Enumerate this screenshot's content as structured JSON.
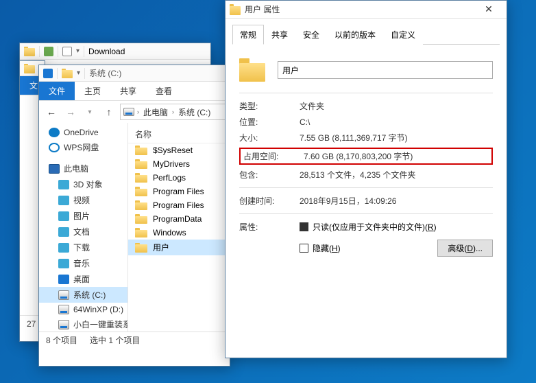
{
  "win_download": {
    "title": "Download"
  },
  "win_c": {
    "title": "系统 (C:)",
    "ribbon": {
      "file": "文件",
      "home": "主页",
      "share": "共享",
      "view": "查看"
    },
    "breadcrumb": {
      "pc": "此电脑",
      "c": "系统 (C:)"
    },
    "tree": {
      "onedrive": "OneDrive",
      "wps": "WPS网盘",
      "thispc": "此电脑",
      "threed": "3D 对象",
      "video": "视频",
      "pictures": "图片",
      "docs": "文档",
      "downloads": "下载",
      "music": "音乐",
      "desktop": "桌面",
      "c": "系统 (C:)",
      "d": "64WinXP  (D:)",
      "e": "小白一键重装系"
    },
    "list_header": "名称",
    "items": {
      "sysreset": "$SysReset",
      "mydrivers": "MyDrivers",
      "perflogs": "PerfLogs",
      "pf": "Program Files",
      "pf2": "Program Files",
      "pd": "ProgramData",
      "win": "Windows",
      "users": "用户"
    },
    "status": {
      "count": "8 个项目",
      "selected": "选中 1 个项目"
    }
  },
  "win_c_partial": {
    "status_count": "27"
  },
  "props": {
    "title": "用户 属性",
    "tabs": {
      "general": "常规",
      "share": "共享",
      "security": "安全",
      "prev": "以前的版本",
      "custom": "自定义"
    },
    "name": "用户",
    "type_label": "类型:",
    "type": "文件夹",
    "loc_label": "位置:",
    "loc": "C:\\",
    "size_label": "大小:",
    "size": "7.55 GB (8,111,369,717 字节)",
    "ondisk_label": "占用空间:",
    "ondisk": "7.60 GB (8,170,803,200 字节)",
    "contains_label": "包含:",
    "contains": "28,513 个文件，4,235 个文件夹",
    "created_label": "创建时间:",
    "created": "2018年9月15日，14:09:26",
    "attr_label": "属性:",
    "readonly": "只读(仅应用于文件夹中的文件)(",
    "readonly_k": "R",
    "hidden": "隐藏(",
    "hidden_k": "H",
    "advanced": "高级(",
    "advanced_k": "D",
    "advanced_suf": ")..."
  }
}
